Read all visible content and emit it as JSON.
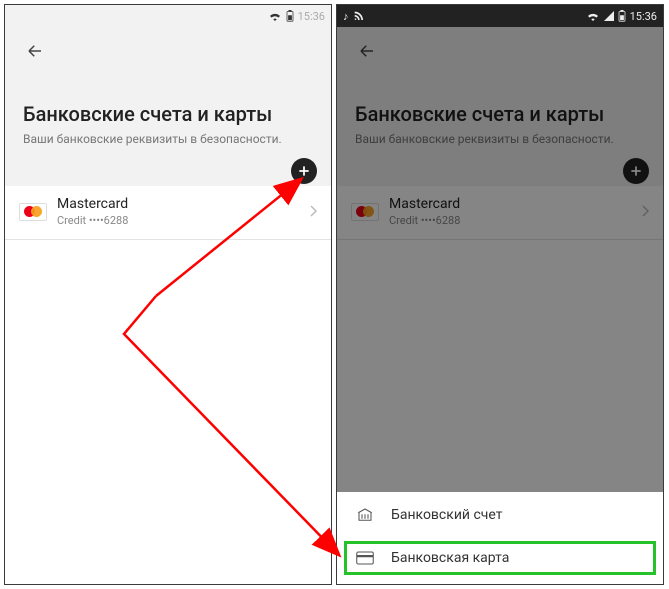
{
  "status_bar_left": {
    "time_left": "15:36"
  },
  "status_bar_right": {
    "time": "15:36"
  },
  "page": {
    "title": "Банковские счета и карты",
    "subtitle": "Ваши банковские реквизиты в безопасности."
  },
  "card": {
    "brand": "Mastercard",
    "detail": "Credit ••••6288"
  },
  "sheet": {
    "option_account": "Банковский счет",
    "option_card": "Банковская карта"
  },
  "colors": {
    "highlight": "#26c229",
    "arrow": "#ff0000"
  }
}
